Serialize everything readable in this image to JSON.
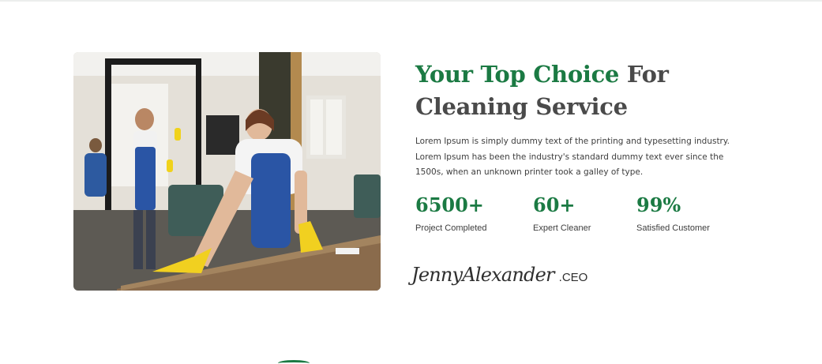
{
  "about": {
    "photo_alt": "Cleaning staff wiping tables and glass in an office",
    "headline_accent": "Your Top Choice",
    "headline_rest_1": "For",
    "headline_rest_2": "Cleaning Service",
    "description": "Lorem Ipsum is simply dummy text of the printing and typesetting  industry. Lorem Ipsum has been the industry's standard dummy text ever since the 1500s, when an unknown printer took a galley of type.",
    "stats": [
      {
        "value": "6500+",
        "label": "Project Completed"
      },
      {
        "value": "60+",
        "label": "Expert Cleaner"
      },
      {
        "value": "99%",
        "label": "Satisfied Customer"
      }
    ],
    "signature_name": "JennyAlexander",
    "signature_role": ".CEO"
  },
  "colors": {
    "accent": "#1b7a43",
    "heading": "#4a4a4a",
    "body_text": "#3d3d3d"
  }
}
